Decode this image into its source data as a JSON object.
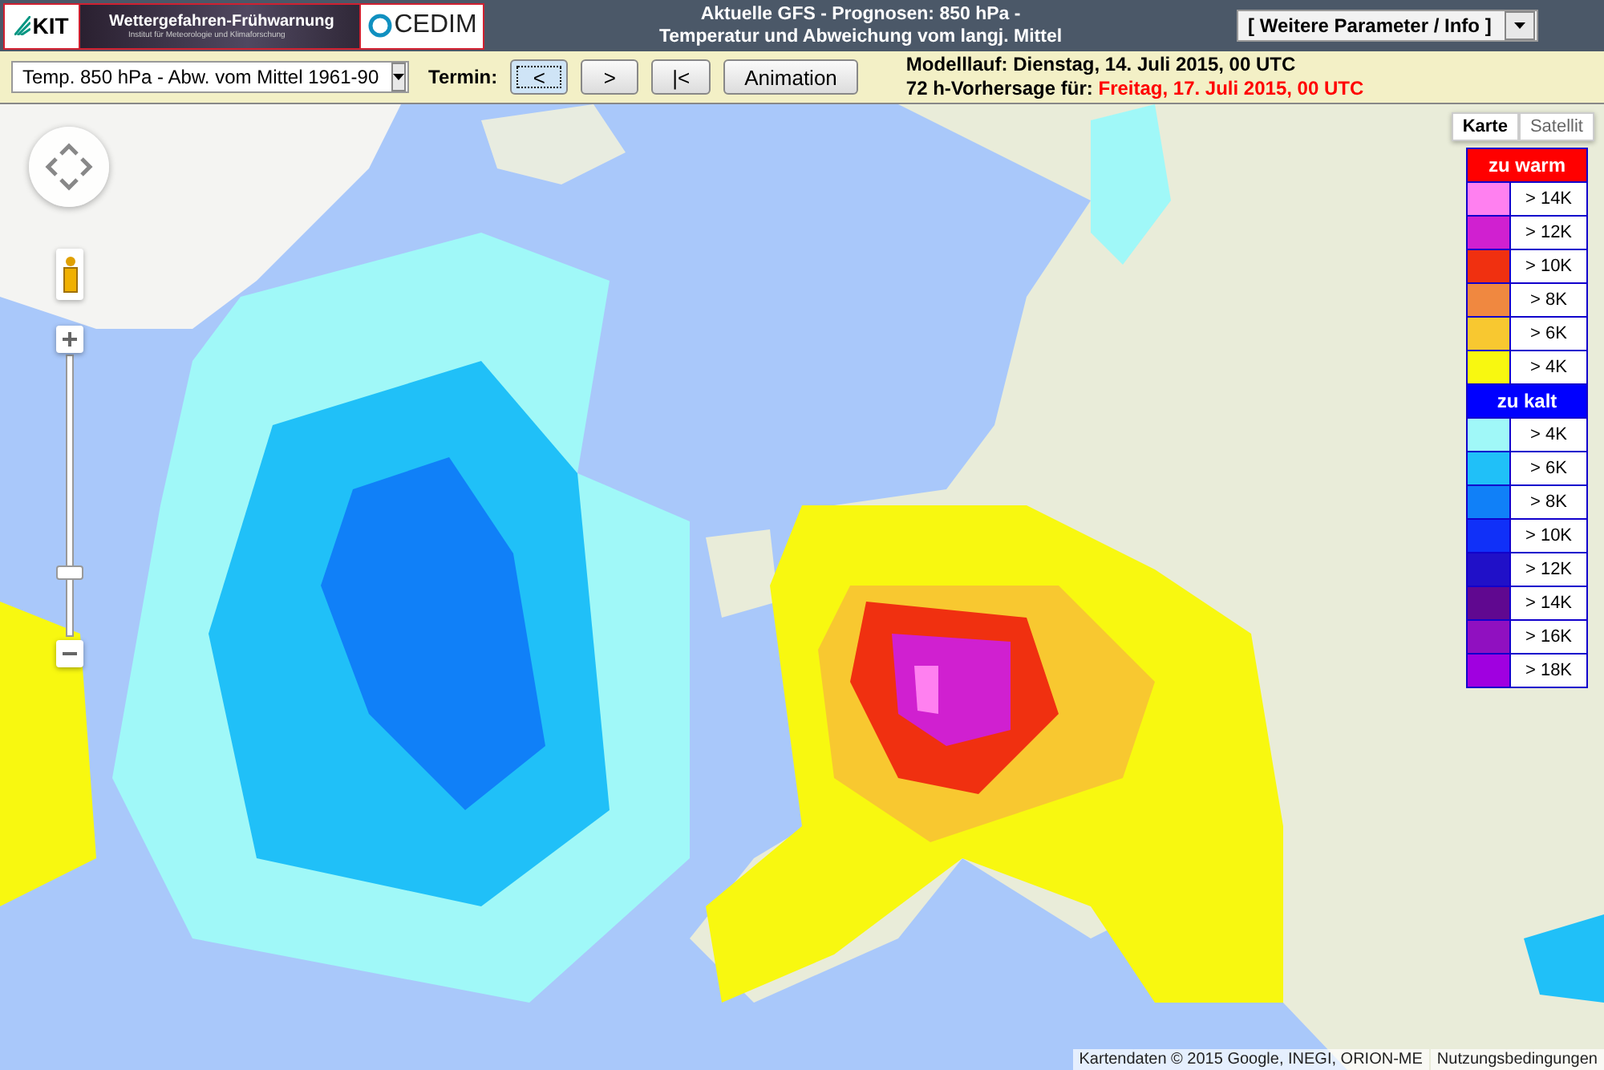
{
  "header": {
    "logos": {
      "kit": "KIT",
      "banner_title": "Wettergefahren-Frühwarnung",
      "banner_subtitle": "Institut für Meteorologie und Klimaforschung",
      "cedim": "CEDIM"
    },
    "title_lines": [
      "Aktuelle GFS - Prognosen: 850 hPa -",
      "Temperatur und Abweichung vom langj. Mittel"
    ],
    "info_select": {
      "value": "[ Weitere Parameter / Info ]"
    }
  },
  "toolbar": {
    "parameter_select": {
      "value": "Temp. 850 hPa - Abw. vom Mittel 1961-90"
    },
    "termin_label": "Termin:",
    "buttons": [
      {
        "label": "<",
        "focused": true
      },
      {
        "label": ">",
        "focused": false
      },
      {
        "label": "|<",
        "focused": false
      },
      {
        "label": "Animation",
        "focused": false
      }
    ],
    "run_label": "Modelllauf:",
    "run_value": "Dienstag, 14. Juli 2015, 00 UTC",
    "forecast_label": "72 h-Vorhersage für:",
    "forecast_value": "Freitag, 17. Juli 2015, 00 UTC"
  },
  "map": {
    "map_types": [
      {
        "label": "Karte",
        "selected": true
      },
      {
        "label": "Satellit",
        "selected": false
      }
    ],
    "zoom": {
      "level": 0.23
    },
    "legend": [
      {
        "title": "zu warm",
        "color": "#ff0000",
        "entries": [
          {
            "label": "> 14K",
            "color": "#ff80f0"
          },
          {
            "label": "> 12K",
            "color": "#d020d0"
          },
          {
            "label": "> 10K",
            "color": "#f03010"
          },
          {
            "label": "> 8K",
            "color": "#f08840"
          },
          {
            "label": "> 6K",
            "color": "#f8c830"
          },
          {
            "label": "> 4K",
            "color": "#f8f810"
          }
        ]
      },
      {
        "title": "zu kalt",
        "color": "#0000ff",
        "entries": [
          {
            "label": "> 4K",
            "color": "#a0f8f8"
          },
          {
            "label": "> 6K",
            "color": "#20c0f8"
          },
          {
            "label": "> 8K",
            "color": "#1080f8"
          },
          {
            "label": "> 10K",
            "color": "#1030f8"
          },
          {
            "label": "> 12K",
            "color": "#2010c8"
          },
          {
            "label": "> 14K",
            "color": "#600890"
          },
          {
            "label": "> 16K",
            "color": "#9010c0"
          },
          {
            "label": "> 18K",
            "color": "#a000e0"
          }
        ]
      }
    ],
    "attribution": "Kartendaten © 2015 Google, INEGI, ORION-ME",
    "terms_link": "Nutzungsbedingungen"
  }
}
